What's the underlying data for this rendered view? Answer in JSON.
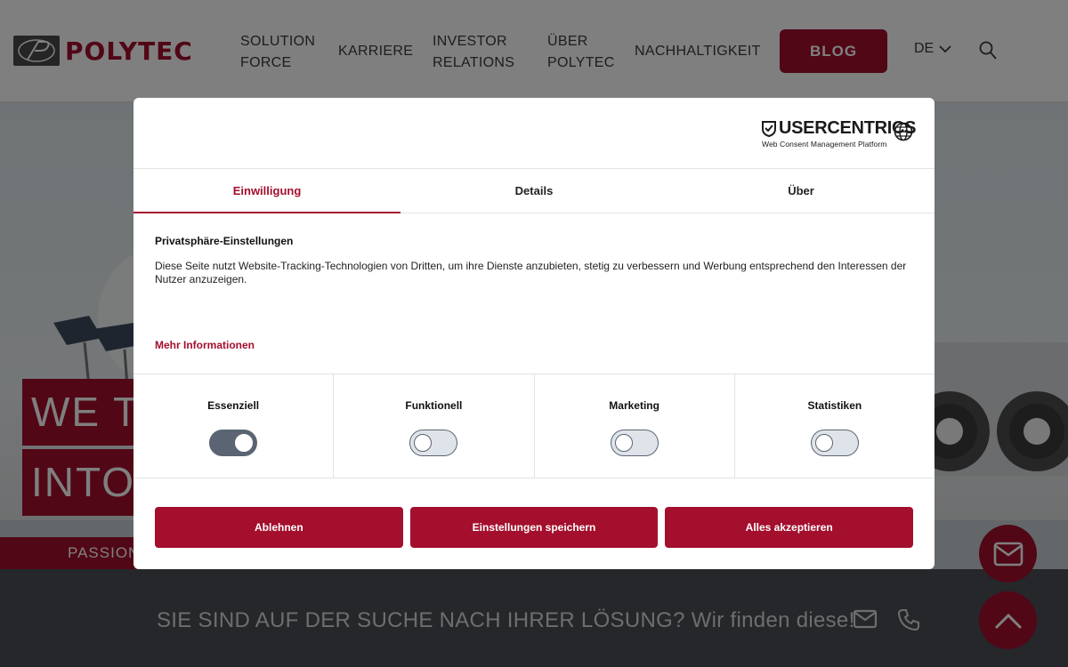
{
  "header": {
    "logo_text": "POLYTEC",
    "nav": [
      {
        "line1": "SOLUTION",
        "line2": "FORCE"
      },
      {
        "line1": "KARRIERE",
        "line2": ""
      },
      {
        "line1": "INVESTOR",
        "line2": "RELATIONS"
      },
      {
        "line1": "ÜBER",
        "line2": "POLYTEC"
      },
      {
        "line1": "NACHHALTIGKEIT",
        "line2": ""
      }
    ],
    "blog_label": "BLOG",
    "lang": "DE"
  },
  "hero": {
    "slogan_line1": "WE T",
    "slogan_line2": "INTO",
    "passion": "PASSION"
  },
  "footer": {
    "cta_text": "SIE SIND AUF DER SUCHE NACH IHRER LÖSUNG? Wir finden diese!"
  },
  "consent": {
    "brand": "USERCENTRICS",
    "brand_sub": "Web Consent Management Platform",
    "tabs": [
      "Einwilligung",
      "Details",
      "Über"
    ],
    "active_tab": "Einwilligung",
    "heading": "Privatsphäre-Einstellungen",
    "text": "Diese Seite nutzt Website-Tracking-Technologien von Dritten, um ihre Dienste anzubieten, stetig zu verbessern und Werbung entsprechend den Interessen der Nutzer anzuzeigen.",
    "more_info": "Mehr Informationen",
    "categories": [
      {
        "label": "Essenziell",
        "enabled": true
      },
      {
        "label": "Funktionell",
        "enabled": false
      },
      {
        "label": "Marketing",
        "enabled": false
      },
      {
        "label": "Statistiken",
        "enabled": false
      }
    ],
    "buttons": {
      "reject": "Ablehnen",
      "save": "Einstellungen speichern",
      "accept_all": "Alles akzeptieren"
    }
  },
  "colors": {
    "brand_red": "#a30f2d",
    "toggle_gray": "#5a6472"
  }
}
